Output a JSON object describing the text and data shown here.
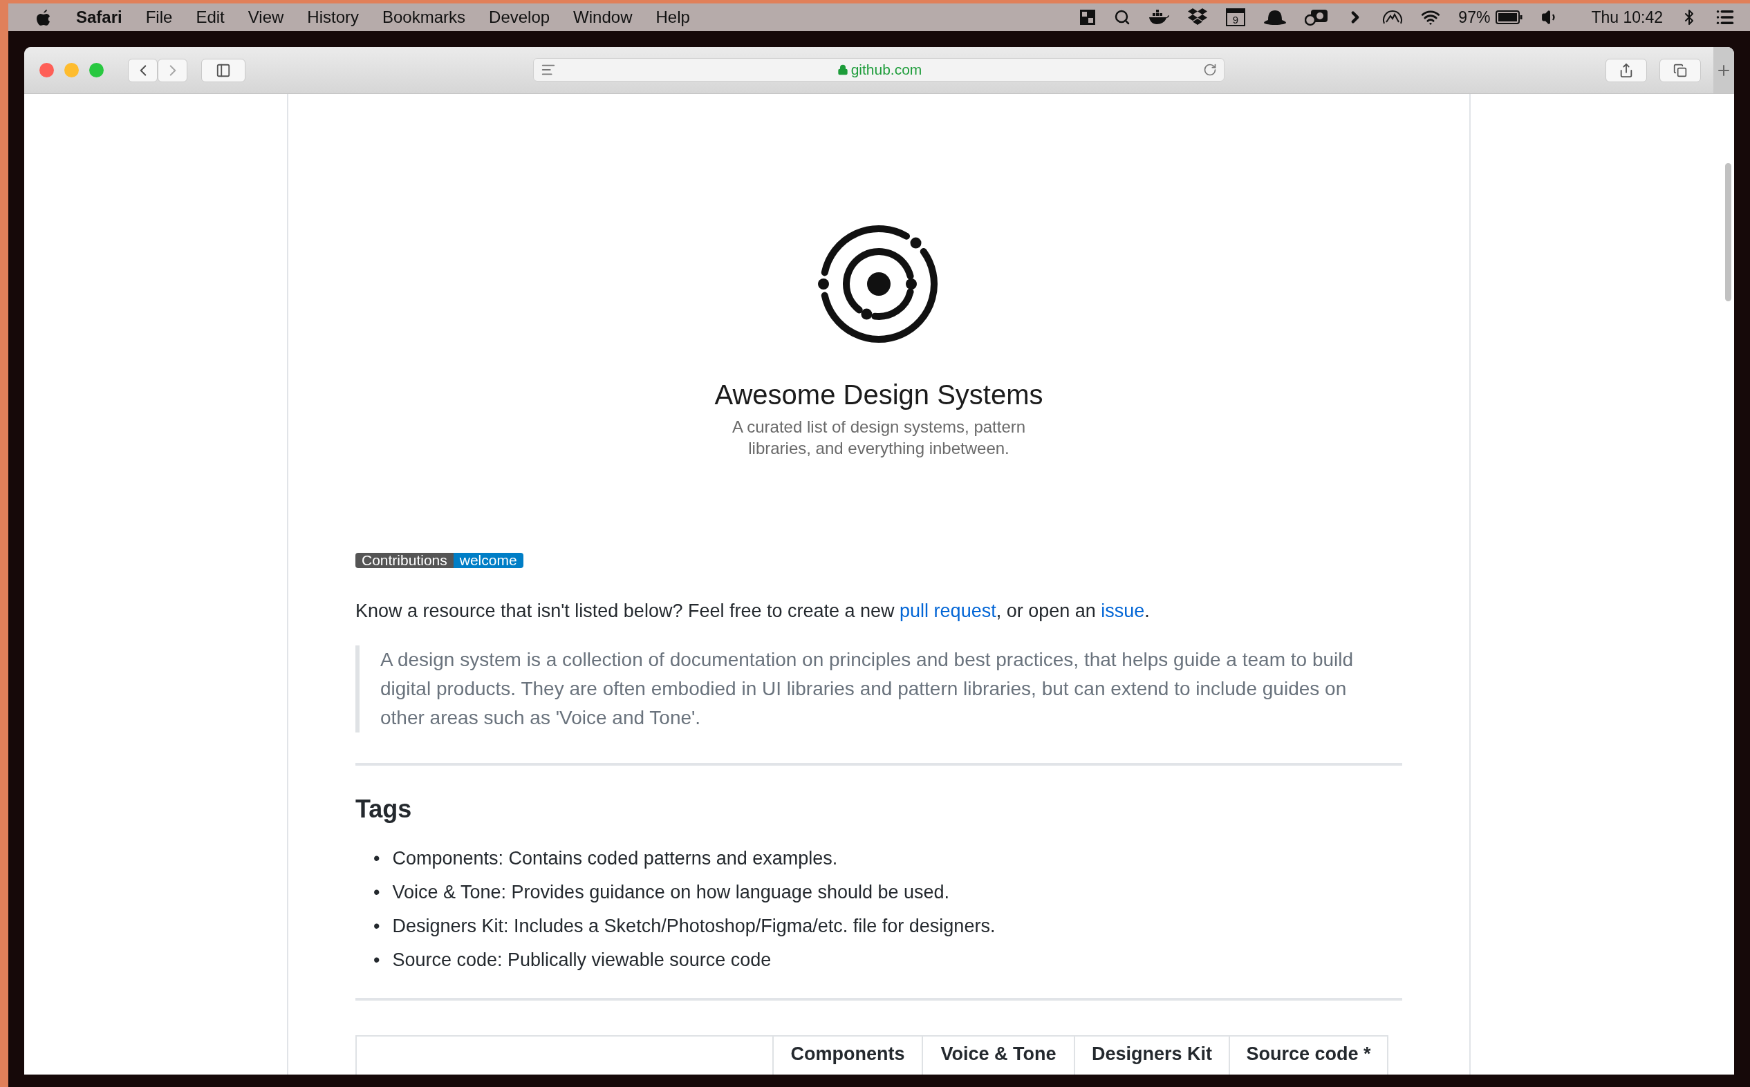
{
  "menu_bar": {
    "app": "Safari",
    "items": [
      "File",
      "Edit",
      "View",
      "History",
      "Bookmarks",
      "Develop",
      "Window",
      "Help"
    ],
    "calendar_day": "9",
    "battery_percent": "97%",
    "clock": "Thu 10:42"
  },
  "browser": {
    "address": "github.com",
    "secure": true
  },
  "page": {
    "title": "Awesome Design Systems",
    "subtitle": "A curated list of design systems, pattern libraries, and everything inbetween.",
    "badge": {
      "label": "Contributions",
      "message": "welcome"
    },
    "intro": [
      {
        "kind": "text",
        "text": "Know a resource that isn't listed below? Feel free to create a new "
      },
      {
        "kind": "link",
        "text": "pull request"
      },
      {
        "kind": "text",
        "text": ", or open an "
      },
      {
        "kind": "link",
        "text": "issue"
      },
      {
        "kind": "text",
        "text": "."
      }
    ],
    "quote": "A design system is a collection of documentation on principles and best practices, that helps guide a team to build digital products. They are often embodied in UI libraries and pattern libraries, but can extend to include guides on other areas such as 'Voice and Tone'.",
    "tags_heading": "Tags",
    "tags": [
      {
        "marker": "•",
        "text": "Components: Contains coded patterns and examples."
      },
      {
        "marker": "•",
        "text": "Voice & Tone: Provides guidance on how language should be used."
      },
      {
        "marker": "•",
        "text": "Designers Kit: Includes a Sketch/Photoshop/Figma/etc. file for designers."
      },
      {
        "marker": "•",
        "text": "Source code: Publically viewable source code"
      }
    ],
    "table": {
      "columns": [
        "Components",
        "Voice & Tone",
        "Designers Kit",
        "Source code *"
      ]
    }
  }
}
